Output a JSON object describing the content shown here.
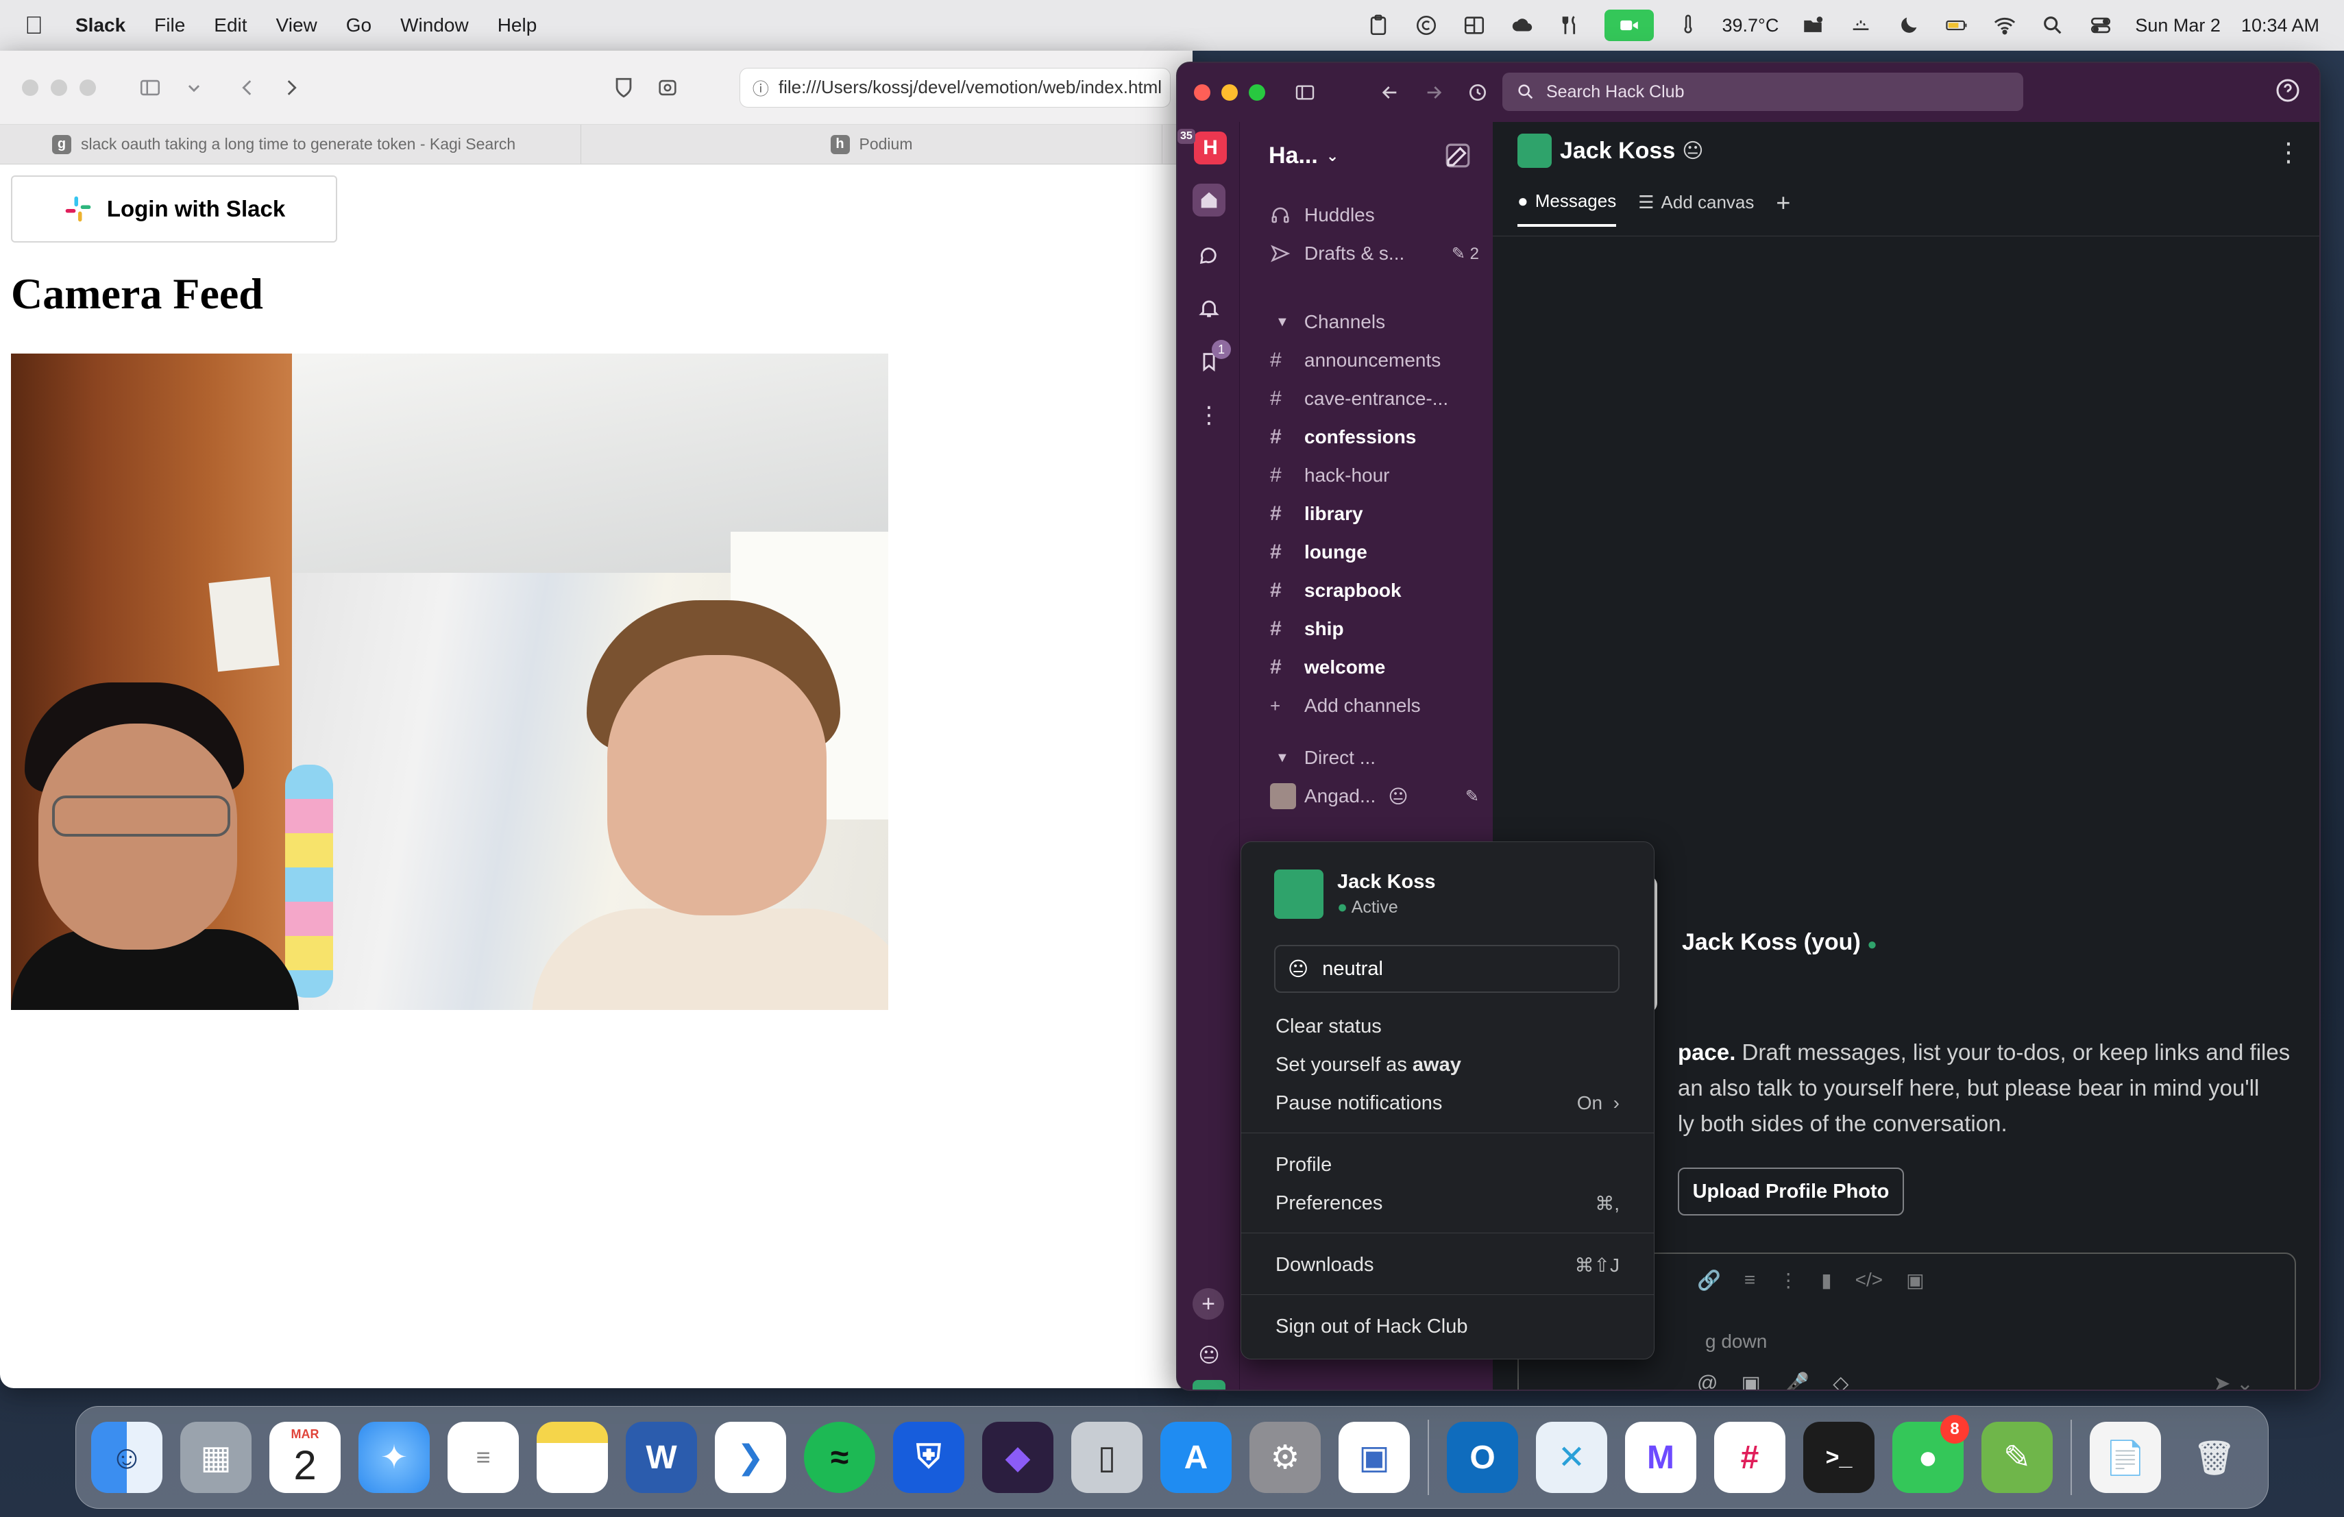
{
  "menubar": {
    "app": "Slack",
    "items": [
      "File",
      "Edit",
      "View",
      "Go",
      "Window",
      "Help"
    ],
    "temperature": "39.7°C",
    "date": "Sun Mar 2",
    "time": "10:34 AM"
  },
  "browser": {
    "url": "file:///Users/kossj/devel/vemotion/web/index.html",
    "tabs": [
      {
        "title": "slack oauth taking a long time to generate token - Kagi Search",
        "favicon": "g"
      },
      {
        "title": "Podium",
        "favicon": "h"
      }
    ],
    "login_button": "Login with Slack",
    "heading": "Camera Feed"
  },
  "slack": {
    "search_placeholder": "Search Hack Club",
    "workspace_short": "Ha...",
    "workspace_badge": "35",
    "rail_badge": "1",
    "sidebar": {
      "huddles": "Huddles",
      "drafts": "Drafts & s...",
      "drafts_count": "2",
      "channels_header": "Channels",
      "channels": [
        {
          "name": "announcements",
          "bold": false
        },
        {
          "name": "cave-entrance-...",
          "bold": false
        },
        {
          "name": "confessions",
          "bold": true
        },
        {
          "name": "hack-hour",
          "bold": false
        },
        {
          "name": "library",
          "bold": true
        },
        {
          "name": "lounge",
          "bold": true
        },
        {
          "name": "scrapbook",
          "bold": true
        },
        {
          "name": "ship",
          "bold": true
        },
        {
          "name": "welcome",
          "bold": true
        }
      ],
      "add_channels": "Add channels",
      "direct_header": "Direct ...",
      "dm_first": "Angad..."
    },
    "header": {
      "name": "Jack Koss",
      "tabs": [
        "Messages",
        "Add canvas"
      ]
    },
    "intro": {
      "name": "Jack Koss (you)",
      "line1_bold": "pace.",
      "line1": " Draft messages, list your to-dos, or keep links and files",
      "line2": "an also talk to yourself here, but please bear in mind you'll",
      "line3": "ly both sides of the conversation.",
      "upload_button": "Upload Profile Photo"
    },
    "composer": {
      "placeholder_partial": "g down"
    },
    "status_menu": {
      "name": "Jack Koss",
      "presence": "Active",
      "status_text": "neutral",
      "clear_status": "Clear status",
      "set_away_prefix": "Set yourself as ",
      "set_away_bold": "away",
      "pause_notifications": "Pause notifications",
      "pause_value": "On",
      "profile": "Profile",
      "preferences": "Preferences",
      "preferences_shortcut": "⌘,",
      "downloads": "Downloads",
      "downloads_shortcut": "⌘⇧J",
      "sign_out": "Sign out of Hack Club"
    }
  },
  "dock": {
    "calendar_month": "MAR",
    "calendar_day": "2",
    "messages_badge": "8",
    "colors": {
      "finder": "#3b8ef0",
      "launchpad": "#9aa3ad",
      "safari": "#2f8cf0",
      "reminders": "#ffffff",
      "notes": "#f5d54a",
      "word": "#2b5cad",
      "vscode": "#2a7ad6",
      "spotify": "#1db954",
      "bitwarden": "#175ddc",
      "obsidian": "#6b3fb0",
      "iphone-mirror": "#c8cdd3",
      "appstore": "#1f8cf2",
      "settings": "#8e8e93",
      "screen-share": "#3a6bc4",
      "outlook": "#0f6cbd",
      "xcode-tool": "#e8f0f8",
      "proton-mail": "#6d4aff",
      "slack": "#ffffff",
      "terminal": "#1c1c1c",
      "messages": "#34c759",
      "gpt-pencil": "#6fb64a",
      "file": "#f4f4f4",
      "trash": "#cfd4d9"
    }
  }
}
